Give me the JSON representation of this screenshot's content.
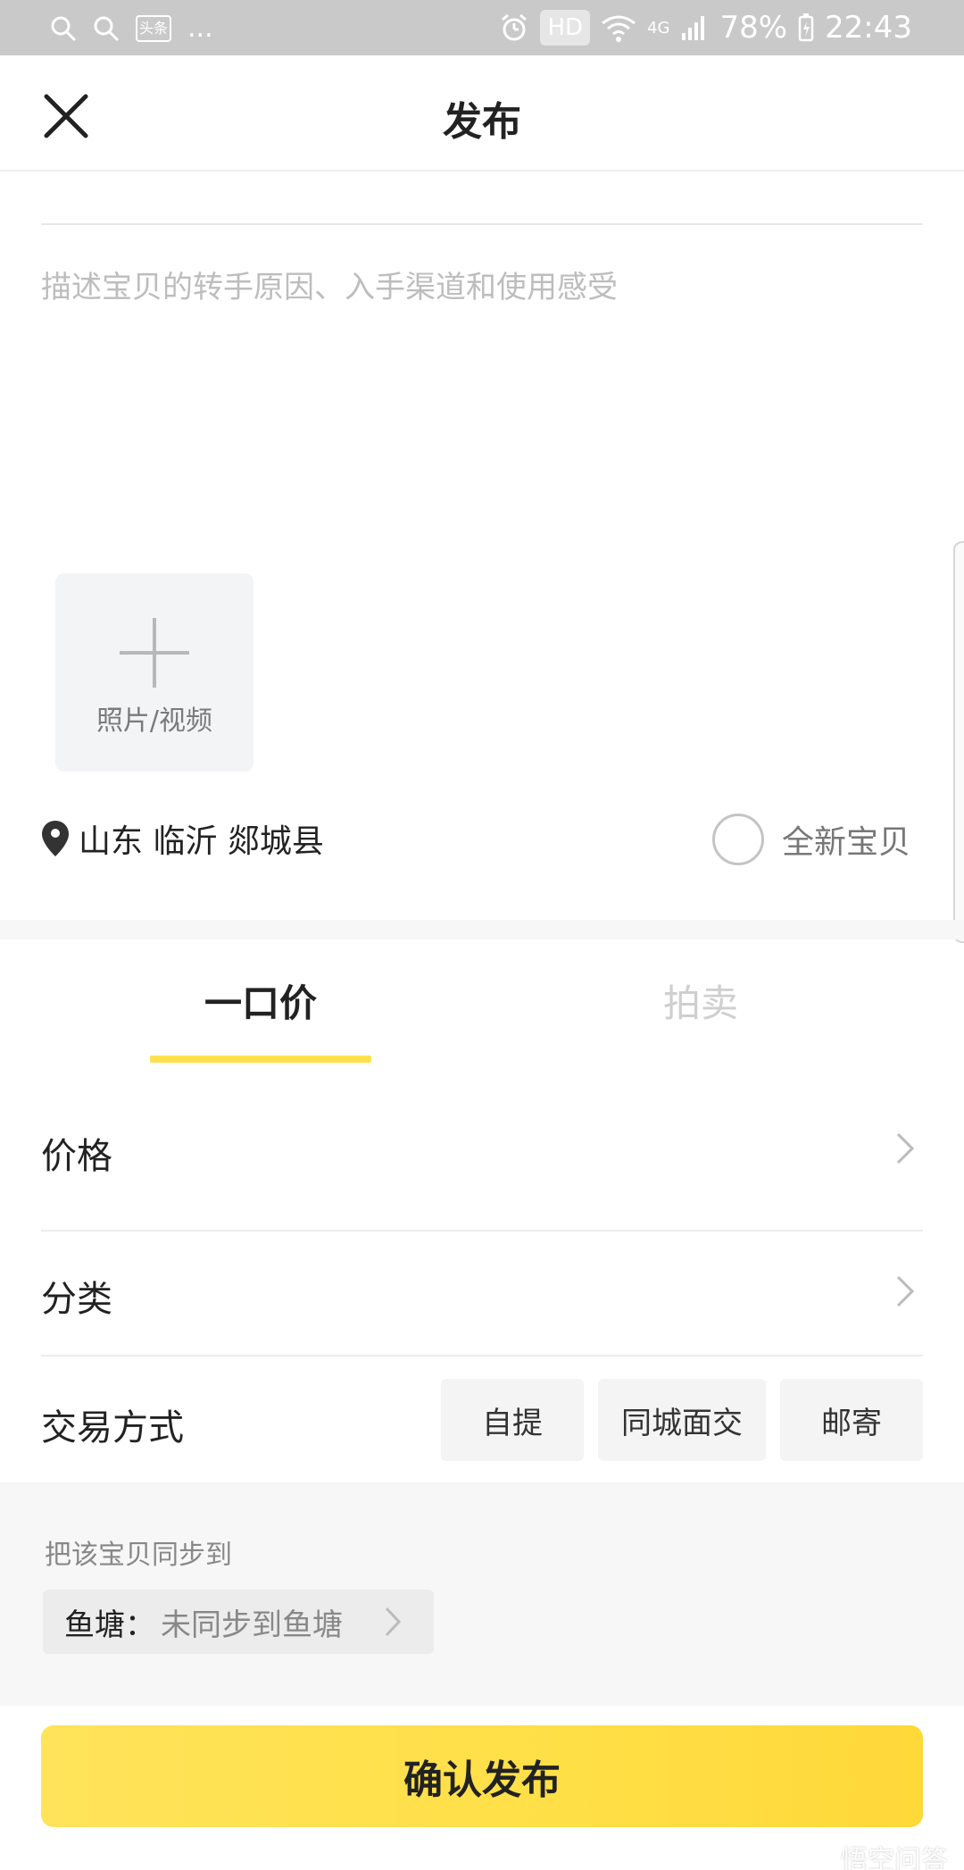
{
  "status_bar": {
    "app_badge": "头条",
    "more": "...",
    "network": "4G",
    "hd_label": "HD",
    "battery": "78%",
    "time": "22:43"
  },
  "header": {
    "title": "发布"
  },
  "description": {
    "placeholder": "描述宝贝的转手原因、入手渠道和使用感受",
    "value": ""
  },
  "media": {
    "add_label": "照片/视频"
  },
  "location": {
    "text": "山东 临沂 郯城县"
  },
  "condition": {
    "brand_new_label": "全新宝贝",
    "checked": false
  },
  "tabs": [
    {
      "label": "一口价",
      "active": true
    },
    {
      "label": "拍卖",
      "active": false
    }
  ],
  "fields": {
    "price_label": "价格",
    "category_label": "分类",
    "trade_method_label": "交易方式",
    "trade_methods": [
      "自提",
      "同城面交",
      "邮寄"
    ]
  },
  "sync": {
    "title": "把该宝贝同步到",
    "target_key": "鱼塘：",
    "target_value": "未同步到鱼塘"
  },
  "confirm_label": "确认发布",
  "watermark": "悟空问答",
  "colors": {
    "accent": "#ffe14d",
    "button_gradient_start": "#ffe35a",
    "button_gradient_end": "#ffd83a"
  }
}
